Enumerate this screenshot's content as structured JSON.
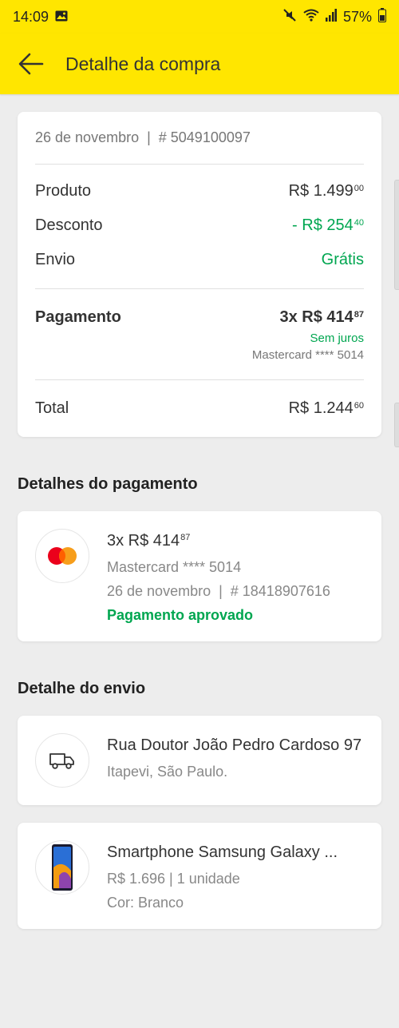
{
  "status": {
    "time": "14:09",
    "battery": "57%"
  },
  "appbar": {
    "title": "Detalhe da compra"
  },
  "summary": {
    "meta": "26 de novembro  |  # 5049100097",
    "produto_label": "Produto",
    "produto_value": "R$ 1.499",
    "produto_cents": "00",
    "desconto_label": "Desconto",
    "desconto_value": "- R$ 254",
    "desconto_cents": "40",
    "envio_label": "Envio",
    "envio_value": "Grátis",
    "pagamento_label": "Pagamento",
    "pagamento_value": "3x R$ 414",
    "pagamento_cents": "87",
    "pagamento_juros": "Sem juros",
    "pagamento_card": "Mastercard **** 5014",
    "total_label": "Total",
    "total_value": "R$ 1.244",
    "total_cents": "60"
  },
  "payment_section": {
    "title": "Detalhes do pagamento",
    "amount": "3x R$ 414",
    "amount_cents": "87",
    "card": "Mastercard **** 5014",
    "meta": "26 de novembro  |  # 18418907616",
    "status": "Pagamento aprovado"
  },
  "shipping_section": {
    "title": "Detalhe do envio",
    "address": "Rua Doutor João Pedro Cardoso 97",
    "city": "Itapevi, São Paulo."
  },
  "product": {
    "name": "Smartphone Samsung Galaxy ...",
    "price_qty": "R$ 1.696 | 1 unidade",
    "color": "Cor: Branco"
  },
  "colors": {
    "brand_yellow": "#ffe600",
    "green": "#00a650"
  },
  "icons": [
    "image-icon",
    "mute-icon",
    "wifi-icon",
    "signal-icon",
    "battery-icon",
    "back-arrow-icon",
    "mastercard-icon",
    "truck-icon",
    "phone-product-icon"
  ]
}
